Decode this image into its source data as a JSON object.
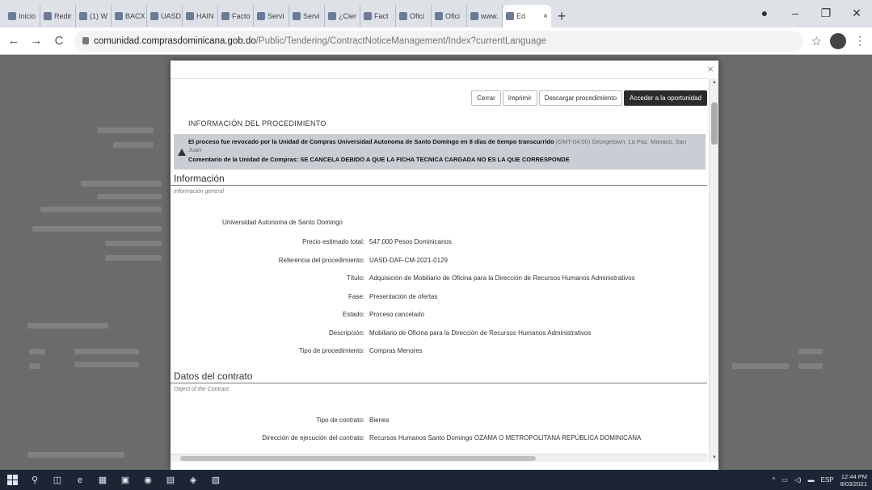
{
  "browser": {
    "tabs": [
      {
        "title": "Inicio"
      },
      {
        "title": "Redir"
      },
      {
        "title": "(1) W"
      },
      {
        "title": "BACX"
      },
      {
        "title": "UASD"
      },
      {
        "title": "HAIN"
      },
      {
        "title": "Facto"
      },
      {
        "title": "Servi"
      },
      {
        "title": "Servi"
      },
      {
        "title": "¿Cier"
      },
      {
        "title": "Fact"
      },
      {
        "title": "Ofici"
      },
      {
        "title": "Ofici"
      },
      {
        "title": "www."
      }
    ],
    "active_tab": "Ed",
    "url_host": "comunidad.comprasdominicana.gob.do",
    "url_path": "/Public/Tendering/ContractNoticeManagement/Index?currentLanguage"
  },
  "modal": {
    "close_icon": "×",
    "buttons": {
      "close": "Cerrar",
      "print": "Imprimir",
      "download": "Descargar procedimiento",
      "access": "Acceder a la oportunidad"
    },
    "section_title": "INFORMACIÓN DEL PROCEDIMIENTO",
    "warning": {
      "line1": "El proceso fue revocado por la Unidad de Compras Universidad Autonoma de Santo Domingo en 8 días de tiempo transcurrido",
      "line1_extra": "(GMT-04:00) Georgetown, La Paz, Manaus, San Juan",
      "comment_label": "Comentario de la Unidad de Compras:",
      "comment_text": "SE CANCELA DEBIDO A QUE LA FICHA TECNICA CARGADA NO ES LA QUE CORRESPONDE"
    },
    "info": {
      "heading": "Información",
      "subheading": "Información general",
      "entity": "Universidad Autonoma de Santo Domingo",
      "fields": [
        {
          "label": "Precio estimado total:",
          "value": "547,000 Pesos Dominicanos"
        },
        {
          "label": "Referencia del procedimiento:",
          "value": "UASD-DAF-CM-2021-0129"
        },
        {
          "label": "Título:",
          "value": "Adquisición de Mobiliario de Oficina para la Dirección de Recursos Humanos Administrativos"
        },
        {
          "label": "Fase:",
          "value": "Presentación de ofertas"
        },
        {
          "label": "Estado:",
          "value": "Proceso cancelado"
        },
        {
          "label": "Descripción:",
          "value": "Mobiliario de Oficina para la Dirección de Recursos Humanos Administrativos"
        },
        {
          "label": "Tipo de procedimiento:",
          "value": "Compras Menores"
        }
      ]
    },
    "contract": {
      "heading": "Datos del contrato",
      "subheading": "Object of the Contract",
      "fields": [
        {
          "label": "Tipo de contrato:",
          "value": "Bienes"
        },
        {
          "label": "Dirección de ejecución del contrato:",
          "value": "Recursos Humanos Santo Domingo OZAMA O METROPOLITANA REPÚBLICA DOMINICANA"
        }
      ]
    }
  },
  "taskbar": {
    "language": "ESP",
    "time": "12:44 PM",
    "date": "8/03/2021"
  }
}
